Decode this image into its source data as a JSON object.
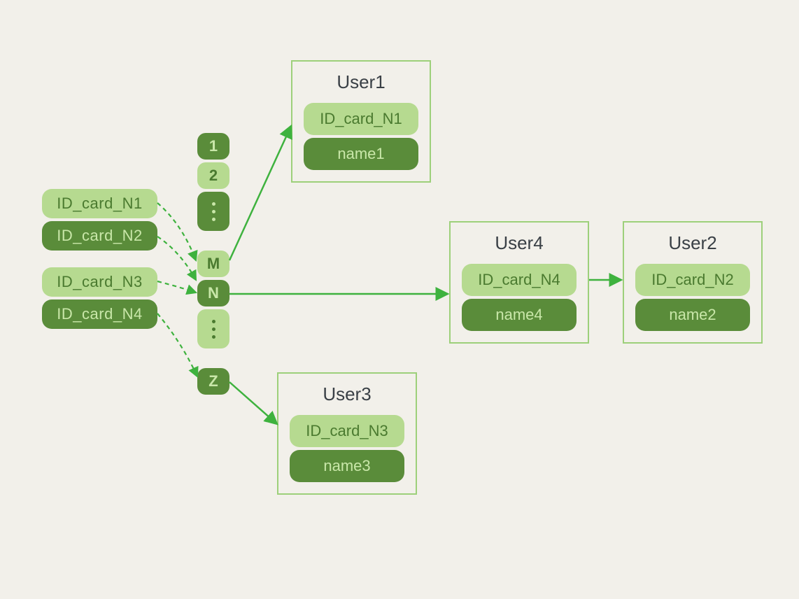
{
  "diagram": {
    "left_keys": [
      {
        "label": "ID_card_N1",
        "shade": "light"
      },
      {
        "label": "ID_card_N2",
        "shade": "dark"
      },
      {
        "label": "ID_card_N3",
        "shade": "light"
      },
      {
        "label": "ID_card_N4",
        "shade": "dark"
      }
    ],
    "buckets": {
      "top": [
        {
          "label": "1",
          "shade": "dark"
        },
        {
          "label": "2",
          "shade": "light"
        }
      ],
      "middle": [
        {
          "label": "M",
          "shade": "light"
        },
        {
          "label": "N",
          "shade": "dark"
        }
      ],
      "bottom": [
        {
          "label": "Z",
          "shade": "dark"
        }
      ]
    },
    "users": {
      "user1": {
        "title": "User1",
        "id": "ID_card_N1",
        "name": "name1"
      },
      "user3": {
        "title": "User3",
        "id": "ID_card_N3",
        "name": "name3"
      },
      "user4": {
        "title": "User4",
        "id": "ID_card_N4",
        "name": "name4"
      },
      "user2": {
        "title": "User2",
        "id": "ID_card_N2",
        "name": "name2"
      }
    },
    "colors": {
      "light_fill": "#b6da90",
      "dark_fill": "#5a8c3a",
      "border": "#9dd07a",
      "arrow": "#3eb23e"
    }
  }
}
